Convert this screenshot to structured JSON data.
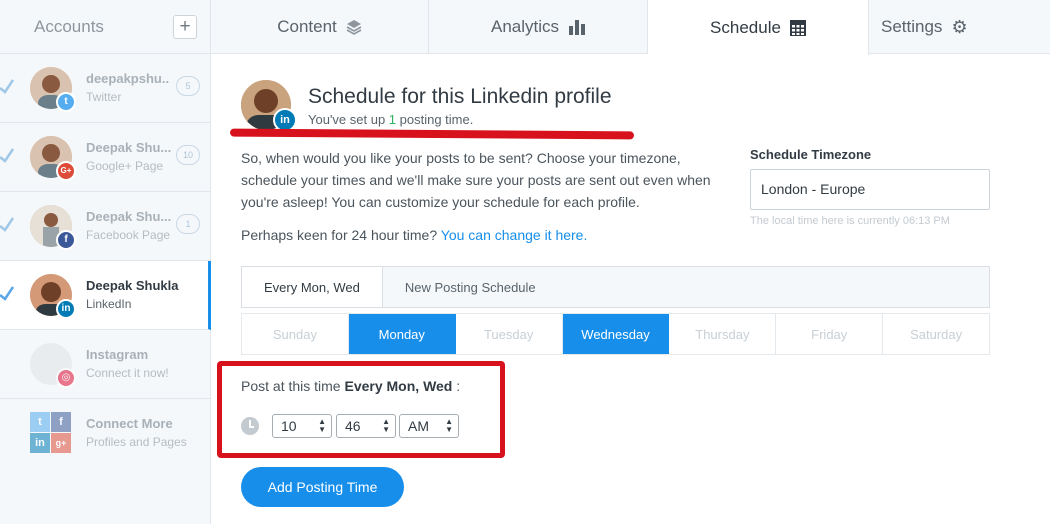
{
  "sidebar": {
    "title": "Accounts",
    "add_label": "+",
    "accounts": [
      {
        "name": "deepakpshu..",
        "type": "Twitter",
        "count": "5",
        "network": "twitter",
        "color": "#55acee",
        "glyph": "t"
      },
      {
        "name": "Deepak Shu...",
        "type": "Google+ Page",
        "count": "10",
        "network": "google-plus",
        "color": "#dd4b39",
        "glyph": "G+"
      },
      {
        "name": "Deepak Shu...",
        "type": "Facebook Page",
        "count": "1",
        "network": "facebook",
        "color": "#3b5998",
        "glyph": "f"
      },
      {
        "name": "Deepak Shukla",
        "type": "LinkedIn",
        "network": "linkedin",
        "color": "#007bb5",
        "glyph": "in"
      },
      {
        "name": "Instagram",
        "type": "Connect it now!",
        "network": "instagram",
        "color": "#e4405f",
        "glyph": "◎"
      },
      {
        "name": "Connect More",
        "type": "Profiles and Pages"
      }
    ],
    "connect_glyphs": [
      "t",
      "f",
      "in",
      "g+"
    ]
  },
  "tabs": [
    {
      "label": "Content",
      "icon": "layers-icon",
      "glyph": "≋"
    },
    {
      "label": "Analytics",
      "icon": "bar-chart-icon",
      "glyph": "▮"
    },
    {
      "label": "Schedule",
      "icon": "calendar-icon",
      "glyph": "▦"
    },
    {
      "label": "Settings",
      "icon": "gear-icon",
      "glyph": "⚙"
    }
  ],
  "profile": {
    "title": "Schedule for this Linkedin profile",
    "sub_before": "You've set up ",
    "sub_count": "1",
    "sub_after": " posting time.",
    "network_glyph": "in"
  },
  "intro": "So, when would you like your posts to be sent? Choose your timezone, schedule your times and we'll make sure your posts are sent out even when you're asleep! You can customize your schedule for each profile.",
  "keen": {
    "text": "Perhaps keen for 24 hour time? ",
    "link": "You can change it here."
  },
  "timezone": {
    "label": "Schedule Timezone",
    "value": "London - Europe",
    "note": "The local time here is currently 06:13 PM"
  },
  "schedule_tabs": [
    "Every Mon, Wed",
    "New Posting Schedule"
  ],
  "days": [
    {
      "label": "Sunday",
      "on": false
    },
    {
      "label": "Monday",
      "on": true
    },
    {
      "label": "Tuesday",
      "on": false
    },
    {
      "label": "Wednesday",
      "on": true
    },
    {
      "label": "Thursday",
      "on": false
    },
    {
      "label": "Friday",
      "on": false
    },
    {
      "label": "Saturday",
      "on": false
    }
  ],
  "post": {
    "prefix": "Post at this time ",
    "schedule": "Every Mon, Wed",
    "suffix": " :",
    "hour": "10",
    "minute": "46",
    "ampm": "AM"
  },
  "add_button": "Add Posting Time",
  "colors": {
    "accent": "#168eea",
    "annotation": "#d8121d",
    "success": "#2fb15f"
  }
}
